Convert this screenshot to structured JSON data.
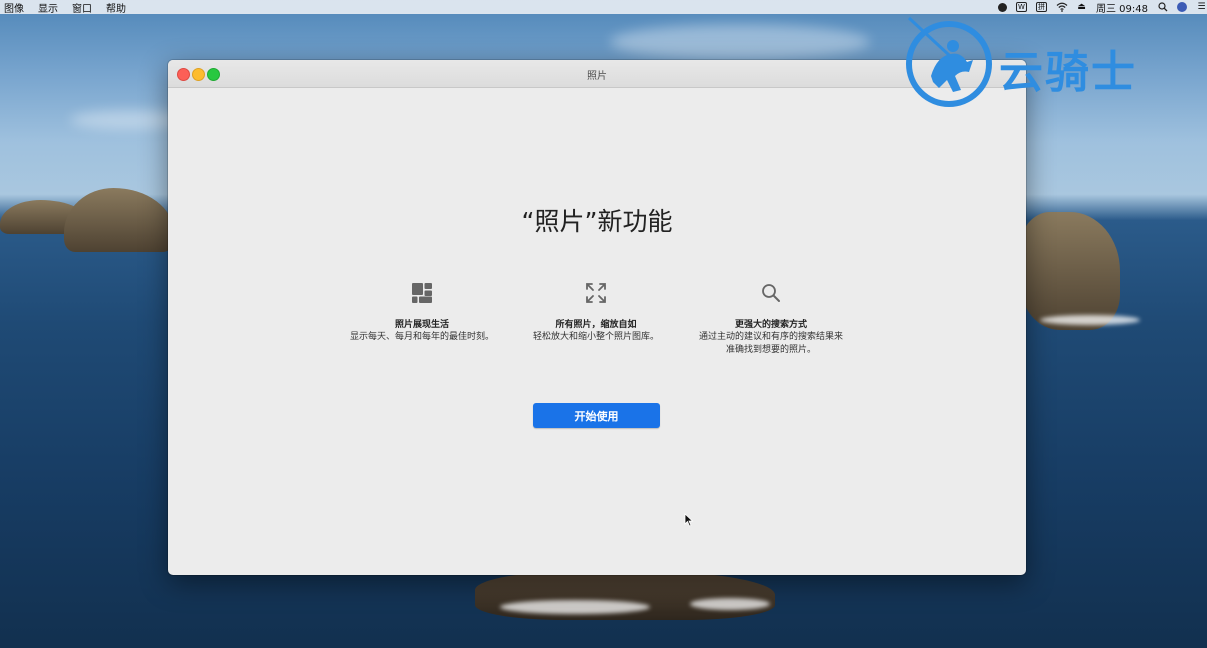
{
  "menubar": {
    "items": [
      "图像",
      "显示",
      "窗口",
      "帮助"
    ],
    "clock": "周三 09:48"
  },
  "window": {
    "title": "照片"
  },
  "main": {
    "headline": "“照片”新功能",
    "features": [
      {
        "icon": "grid-layout-icon",
        "title": "照片展现生活",
        "desc1": "显示每天、每月和每年的最佳时刻。",
        "desc2": ""
      },
      {
        "icon": "expand-arrows-icon",
        "title": "所有照片，缩放自如",
        "desc1": "轻松放大和缩小整个照片图库。",
        "desc2": ""
      },
      {
        "icon": "search-icon",
        "title": "更强大的搜索方式",
        "desc1": "通过主动的建议和有序的搜索结果来",
        "desc2": "准确找到想要的照片。"
      }
    ],
    "start_button": "开始使用"
  },
  "watermark": {
    "text": "云骑士"
  },
  "colors": {
    "accent": "#1a73e8",
    "watermark": "#2f8de0"
  }
}
